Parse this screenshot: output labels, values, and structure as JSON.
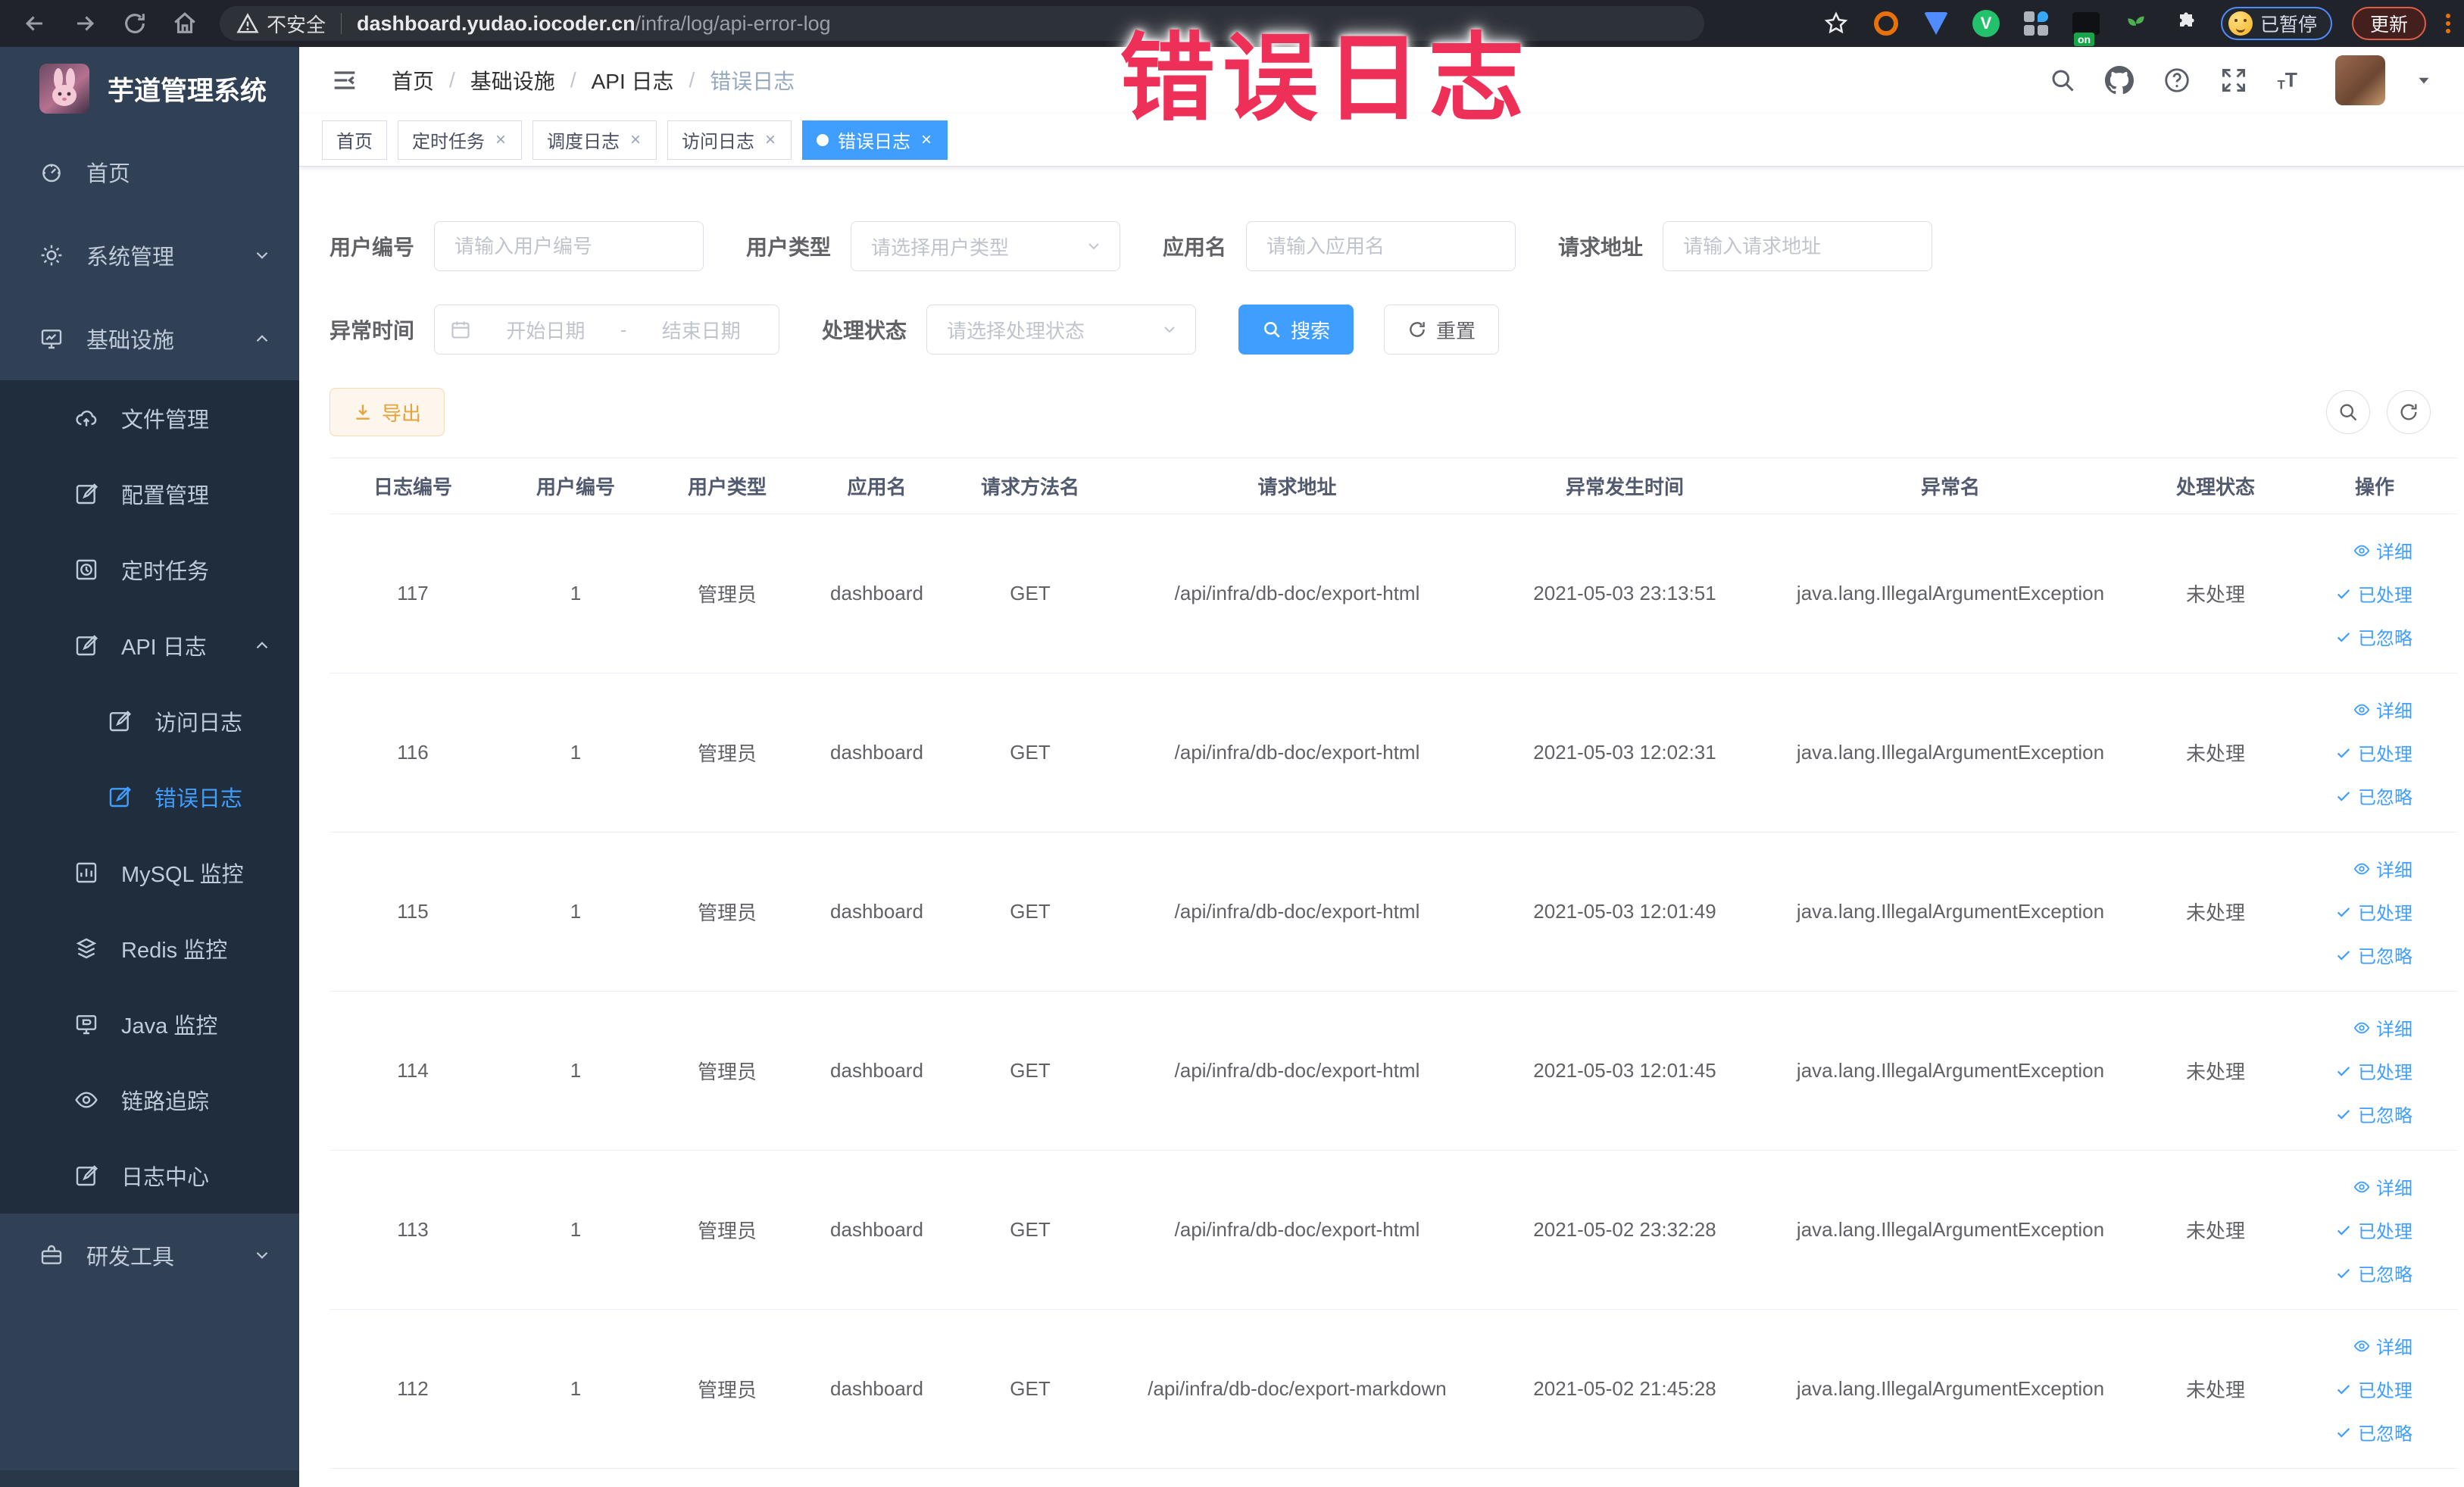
{
  "browser": {
    "security_label": "不安全",
    "url_domain": "dashboard.yudao.iocoder.cn",
    "url_path": "/infra/log/api-error-log",
    "extension_on_badge": "on",
    "paused_chip": "已暂停",
    "update_button": "更新"
  },
  "overlay": {
    "title": "错误日志"
  },
  "sidebar": {
    "logo_title": "芋道管理系统",
    "items": [
      {
        "label": "首页"
      },
      {
        "label": "系统管理"
      },
      {
        "label": "基础设施"
      },
      {
        "label": "文件管理"
      },
      {
        "label": "配置管理"
      },
      {
        "label": "定时任务"
      },
      {
        "label": "API 日志"
      },
      {
        "label": "访问日志"
      },
      {
        "label": "错误日志"
      },
      {
        "label": "MySQL 监控"
      },
      {
        "label": "Redis 监控"
      },
      {
        "label": "Java 监控"
      },
      {
        "label": "链路追踪"
      },
      {
        "label": "日志中心"
      },
      {
        "label": "研发工具"
      }
    ]
  },
  "breadcrumb": {
    "items": [
      "首页",
      "基础设施",
      "API 日志",
      "错误日志"
    ]
  },
  "tabs": [
    {
      "label": "首页",
      "closable": false,
      "active": false
    },
    {
      "label": "定时任务",
      "closable": true,
      "active": false
    },
    {
      "label": "调度日志",
      "closable": true,
      "active": false
    },
    {
      "label": "访问日志",
      "closable": true,
      "active": false
    },
    {
      "label": "错误日志",
      "closable": true,
      "active": true
    }
  ],
  "filters": {
    "user_id": {
      "label": "用户编号",
      "placeholder": "请输入用户编号",
      "value": ""
    },
    "user_type": {
      "label": "用户类型",
      "placeholder": "请选择用户类型",
      "value": ""
    },
    "app_name": {
      "label": "应用名",
      "placeholder": "请输入应用名",
      "value": ""
    },
    "request_url": {
      "label": "请求地址",
      "placeholder": "请输入请求地址",
      "value": ""
    },
    "exception_time": {
      "label": "异常时间",
      "start_placeholder": "开始日期",
      "separator": "-",
      "end_placeholder": "结束日期"
    },
    "process_status": {
      "label": "处理状态",
      "placeholder": "请选择处理状态",
      "value": ""
    },
    "search_label": "搜索",
    "reset_label": "重置"
  },
  "toolbar": {
    "export_label": "导出"
  },
  "table": {
    "columns": [
      "日志编号",
      "用户编号",
      "用户类型",
      "应用名",
      "请求方法名",
      "请求地址",
      "异常发生时间",
      "异常名",
      "处理状态",
      "操作"
    ],
    "actions": {
      "detail": "详细",
      "processed": "已处理",
      "ignored": "已忽略"
    },
    "rows": [
      {
        "id": "117",
        "user_id": "1",
        "user_type": "管理员",
        "app_name": "dashboard",
        "method": "GET",
        "url": "/api/infra/db-doc/export-html",
        "time": "2021-05-03 23:13:51",
        "exception": "java.lang.IllegalArgumentException",
        "status": "未处理"
      },
      {
        "id": "116",
        "user_id": "1",
        "user_type": "管理员",
        "app_name": "dashboard",
        "method": "GET",
        "url": "/api/infra/db-doc/export-html",
        "time": "2021-05-03 12:02:31",
        "exception": "java.lang.IllegalArgumentException",
        "status": "未处理"
      },
      {
        "id": "115",
        "user_id": "1",
        "user_type": "管理员",
        "app_name": "dashboard",
        "method": "GET",
        "url": "/api/infra/db-doc/export-html",
        "time": "2021-05-03 12:01:49",
        "exception": "java.lang.IllegalArgumentException",
        "status": "未处理"
      },
      {
        "id": "114",
        "user_id": "1",
        "user_type": "管理员",
        "app_name": "dashboard",
        "method": "GET",
        "url": "/api/infra/db-doc/export-html",
        "time": "2021-05-03 12:01:45",
        "exception": "java.lang.IllegalArgumentException",
        "status": "未处理"
      },
      {
        "id": "113",
        "user_id": "1",
        "user_type": "管理员",
        "app_name": "dashboard",
        "method": "GET",
        "url": "/api/infra/db-doc/export-html",
        "time": "2021-05-02 23:32:28",
        "exception": "java.lang.IllegalArgumentException",
        "status": "未处理"
      },
      {
        "id": "112",
        "user_id": "1",
        "user_type": "管理员",
        "app_name": "dashboard",
        "method": "GET",
        "url": "/api/infra/db-doc/export-markdown",
        "time": "2021-05-02 21:45:28",
        "exception": "java.lang.IllegalArgumentException",
        "status": "未处理"
      }
    ]
  },
  "colors": {
    "accent": "#409eff",
    "sidebar_bg": "#304156",
    "submenu_bg": "#1f2d3d",
    "warning": "#e6a23c",
    "overlay_pink": "#ee3058"
  }
}
